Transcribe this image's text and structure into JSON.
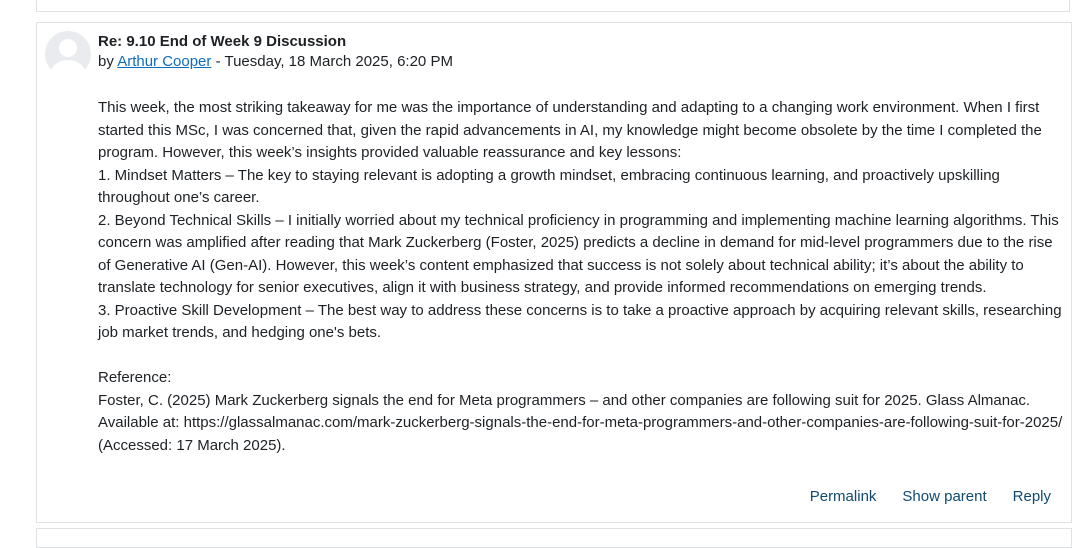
{
  "post": {
    "subject": "Re: 9.10 End of Week 9 Discussion",
    "by_prefix": "by",
    "author": "Arthur Cooper",
    "date_separator": "-",
    "date": "Tuesday, 18 March 2025, 6:20 PM",
    "paragraphs": [
      "This week, the most striking takeaway for me was the importance of understanding and adapting to a changing work environment. When I first started this MSc, I was concerned that, given the rapid advancements in AI, my knowledge might become obsolete by the time I completed the program. However, this week’s insights provided valuable reassurance and key lessons:",
      "1. Mindset Matters – The key to staying relevant is adopting a growth mindset, embracing continuous learning, and proactively upskilling throughout one’s career.",
      "2. Beyond Technical Skills – I initially worried about my technical proficiency in programming and implementing machine learning algorithms. This concern was amplified after reading that Mark Zuckerberg (Foster, 2025) predicts a decline in demand for mid-level programmers due to the rise of Generative AI (Gen-AI). However, this week’s content emphasized that success is not solely about technical ability; it’s about the ability to translate technology for senior executives, align it with business strategy, and provide informed recommendations on emerging trends.",
      "3. Proactive Skill Development – The best way to address these concerns is to take a proactive approach by acquiring relevant skills, researching job market trends, and hedging one's bets."
    ],
    "reference_heading": "Reference:",
    "reference_text": "Foster, C. (2025) Mark Zuckerberg signals the end for Meta programmers – and other companies are following suit for 2025. Glass Almanac. Available at: https://glassalmanac.com/mark-zuckerberg-signals-the-end-for-meta-programmers-and-other-companies-are-following-suit-for-2025/ (Accessed: 17 March 2025).",
    "actions": {
      "permalink": "Permalink",
      "show_parent": "Show parent",
      "reply": "Reply"
    }
  }
}
